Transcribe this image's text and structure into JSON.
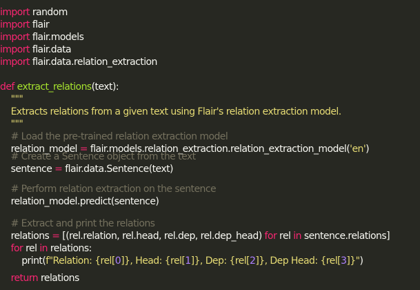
{
  "colors": {
    "background": "#272822",
    "keyword": "#f92672",
    "function": "#a6e22e",
    "string": "#e6db74",
    "comment": "#75715e",
    "number": "#ae81ff",
    "text": "#f8f8f2"
  },
  "code": {
    "imports": [
      {
        "kw": "import",
        "name": " random"
      },
      {
        "kw": "import",
        "name": " flair"
      },
      {
        "kw": "import",
        "name": " flair.models"
      },
      {
        "kw": "import",
        "name": " flair.data"
      },
      {
        "kw": "import",
        "name": " flair.data.relation_extraction"
      }
    ],
    "def_kw": "def",
    "func_name": " extract_relations",
    "func_params": "(text):",
    "doc_open": "    \"\"\"",
    "doc_text": "    Extracts relations from a given text using Flair's relation extraction model.",
    "doc_close": "    \"\"\"",
    "comment_load": "    # Load the pre-trained relation extraction model",
    "l_model_var": "    relation_model ",
    "l_model_eq": "=",
    "l_model_a": " flair",
    "l_model_b": ".models",
    "l_model_c": ".relation_extraction",
    "l_model_d": ".relation_extraction_model(",
    "l_model_str": "'en'",
    "l_model_e": ")",
    "comment_sentence": "    # Create a Sentence object from the text",
    "l_sent_var": "    sentence ",
    "l_sent_eq": "=",
    "l_sent_a": " flair",
    "l_sent_b": ".data",
    "l_sent_c": ".Sentence(text)",
    "comment_predict": "    # Perform relation extraction on the sentence",
    "l_pred_a": "    relation_model",
    "l_pred_b": ".predict(sentence)",
    "comment_extract": "    # Extract and print the relations",
    "l_rel_var": "    relations ",
    "l_rel_eq": "=",
    "l_rel_a": " [(rel",
    "l_rel_b": ".relation, rel",
    "l_rel_c": ".head, rel",
    "l_rel_d": ".dep, rel",
    "l_rel_e": ".dep_head) ",
    "l_rel_for": "for",
    "l_rel_f": " rel ",
    "l_rel_in": "in",
    "l_rel_g": " sentence",
    "l_rel_h": ".relations]",
    "l_for_kw": "    for",
    "l_for_a": " rel ",
    "l_for_in": "in",
    "l_for_b": " relations:",
    "l_print_a": "        print(",
    "l_print_str1": "f\"Relation: {rel[",
    "l_print_n0": "0",
    "l_print_str2": "]}, Head: {rel[",
    "l_print_n1": "1",
    "l_print_str3": "]}, Dep: {rel[",
    "l_print_n2": "2",
    "l_print_str4": "]}, Dep Head: {rel[",
    "l_print_n3": "3",
    "l_print_str5": "]}\"",
    "l_print_b": ")",
    "l_return_kw": "    return",
    "l_return_a": " relations"
  }
}
